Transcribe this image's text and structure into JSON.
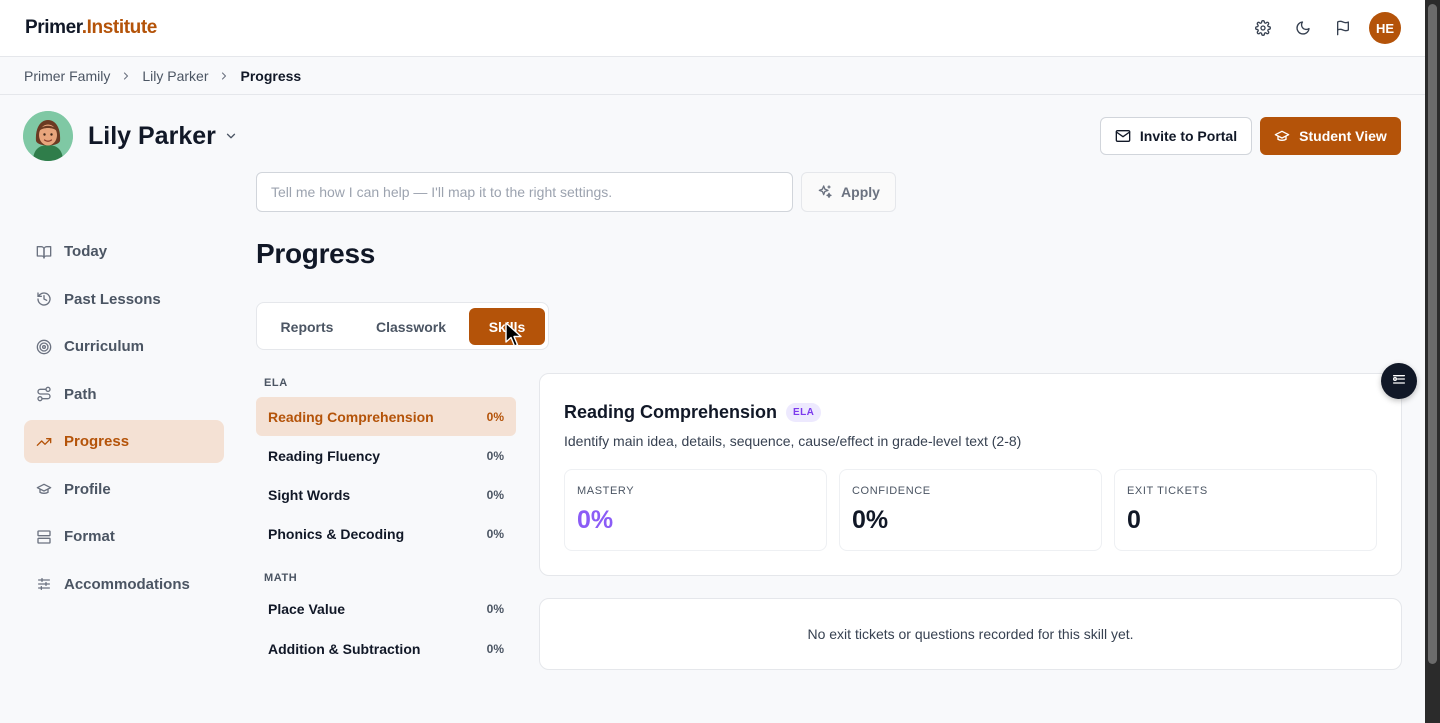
{
  "brand": {
    "name_part1": "Primer",
    "name_part2": ".Institute"
  },
  "topbar": {
    "icons": [
      "gear-icon",
      "moon-icon",
      "flag-icon"
    ],
    "user_initials": "HE"
  },
  "breadcrumb": [
    "Primer Family",
    "Lily Parker",
    "Progress"
  ],
  "student": {
    "name": "Lily Parker"
  },
  "actions": {
    "invite_label": "Invite to Portal",
    "student_view_label": "Student View"
  },
  "help": {
    "placeholder": "Tell me how I can help — I'll map it to the right settings.",
    "apply_label": "Apply"
  },
  "sidebar": {
    "items": [
      {
        "label": "Today",
        "icon": "book-open-icon"
      },
      {
        "label": "Past Lessons",
        "icon": "history-icon"
      },
      {
        "label": "Curriculum",
        "icon": "target-icon"
      },
      {
        "label": "Path",
        "icon": "route-icon"
      },
      {
        "label": "Progress",
        "icon": "trending-up-icon",
        "active": true
      },
      {
        "label": "Profile",
        "icon": "graduation-cap-icon"
      },
      {
        "label": "Format",
        "icon": "layout-icon"
      },
      {
        "label": "Accommodations",
        "icon": "sliders-icon"
      }
    ]
  },
  "page": {
    "title": "Progress"
  },
  "tabs": [
    {
      "label": "Reports"
    },
    {
      "label": "Classwork"
    },
    {
      "label": "Skills",
      "active": true
    }
  ],
  "skills": {
    "groups": [
      {
        "name": "ELA",
        "items": [
          {
            "label": "Reading Comprehension",
            "pct": "0%",
            "active": true
          },
          {
            "label": "Reading Fluency",
            "pct": "0%"
          },
          {
            "label": "Sight Words",
            "pct": "0%"
          },
          {
            "label": "Phonics & Decoding",
            "pct": "0%"
          }
        ]
      },
      {
        "name": "MATH",
        "items": [
          {
            "label": "Place Value",
            "pct": "0%"
          },
          {
            "label": "Addition & Subtraction",
            "pct": "0%"
          }
        ]
      }
    ]
  },
  "detail": {
    "title": "Reading Comprehension",
    "badge": "ELA",
    "description": "Identify main idea, details, sequence, cause/effect in grade-level text (2-8)",
    "stats": [
      {
        "label": "MASTERY",
        "value": "0%"
      },
      {
        "label": "CONFIDENCE",
        "value": "0%"
      },
      {
        "label": "EXIT TICKETS",
        "value": "0"
      }
    ],
    "empty_message": "No exit tickets or questions recorded for this skill yet."
  },
  "colors": {
    "accent": "#b45309",
    "accent_soft": "#f4e1d4",
    "mastery": "#8b5cf6",
    "badge_bg": "#ede9fe"
  }
}
